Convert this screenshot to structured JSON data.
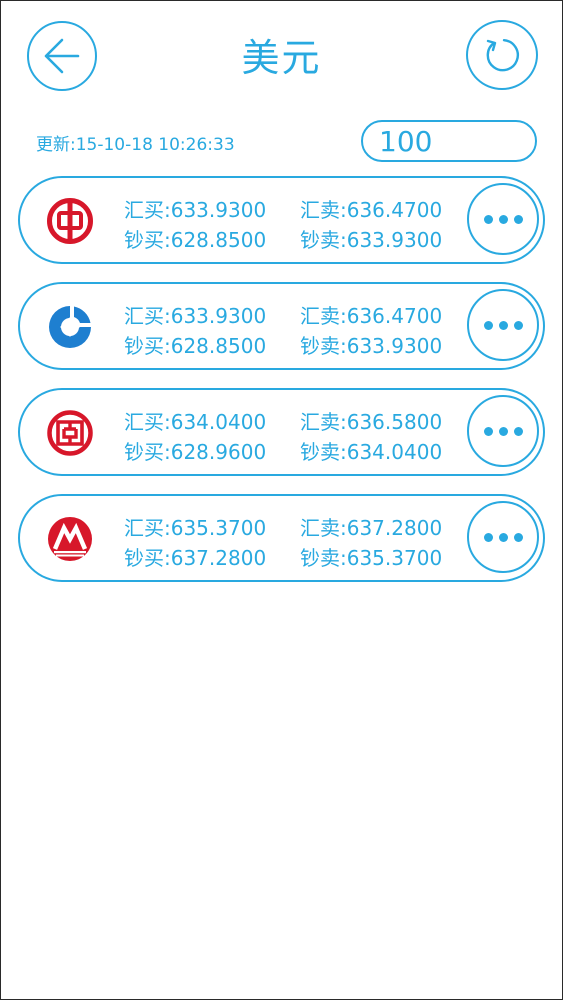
{
  "header": {
    "title": "美元",
    "back_icon": "arrow-left-icon",
    "refresh_icon": "refresh-icon"
  },
  "update_text": "更新:15-10-18 10:26:33",
  "amount_value": "100",
  "colors": {
    "accent": "#29a9e0",
    "bank_red": "#d7172a",
    "ccb_blue": "#1e7fd0"
  },
  "banks": [
    {
      "logo": "bank-of-china-logo",
      "rates": [
        "汇买:633.9300",
        "钞买:628.8500",
        "汇卖:636.4700",
        "钞卖:633.9300"
      ]
    },
    {
      "logo": "ccb-logo",
      "rates": [
        "汇买:633.9300",
        "钞买:628.8500",
        "汇卖:636.4700",
        "钞卖:633.9300"
      ]
    },
    {
      "logo": "icbc-logo",
      "rates": [
        "汇买:634.0400",
        "钞买:628.9600",
        "汇卖:636.5800",
        "钞卖:634.0400"
      ]
    },
    {
      "logo": "cmb-logo",
      "rates": [
        "汇买:635.3700",
        "钞买:637.2800",
        "汇卖:637.2800",
        "钞卖:635.3700"
      ]
    }
  ]
}
